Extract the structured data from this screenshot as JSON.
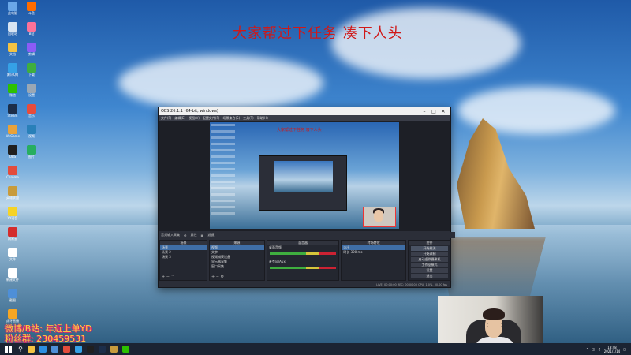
{
  "overlay_banner": "大家帮过下任务 凑下人头",
  "promo_lines": [
    "微博/B站: 年近上单YD",
    "粉丝群: 230459531"
  ],
  "obs": {
    "window_title": "OBS 26.1.1 (64-bit, windows)",
    "menu": [
      "文件(F)",
      "编辑(E)",
      "视图(V)",
      "配置文件(P)",
      "场景集合(S)",
      "工具(T)",
      "帮助(H)"
    ],
    "inner_banner": "大家帮过下任务 凑下人头",
    "controls_bar": [
      "音频输入采集",
      "属性",
      "滤镜"
    ],
    "docks": {
      "scenes": {
        "title": "场景",
        "items": [
          "场景",
          "场景 2",
          "场景 3"
        ]
      },
      "sources": {
        "title": "来源",
        "items": [
          "视频",
          "文字",
          "视频捕获设备",
          "显示器采集",
          "窗口采集"
        ]
      },
      "mixer": {
        "title": "混音器",
        "items": [
          "桌面音频",
          "麦克风/Aux"
        ]
      },
      "transitions": {
        "title": "转场特效",
        "type": "淡出",
        "duration_label": "时长",
        "duration": "300 ms"
      },
      "controls": {
        "title": "控件",
        "buttons": [
          "开始推流",
          "开始录制",
          "启动虚拟摄像机",
          "工作室模式",
          "设置",
          "退出"
        ]
      }
    },
    "status": "LIVE: 00:00:00   REC: 00:00:00   CPU: 1.0%, 30.00 fps"
  },
  "taskbar": {
    "time": "13:48",
    "date": "2021/1/14",
    "apps": [
      {
        "name": "file-explorer",
        "color": "#f3c343"
      },
      {
        "name": "edge",
        "color": "#2c8ee0"
      },
      {
        "name": "store",
        "color": "#4e8fd8"
      },
      {
        "name": "chrome",
        "color": "#e34c3c"
      },
      {
        "name": "qq",
        "color": "#35a1e6"
      },
      {
        "name": "obs",
        "color": "#202020"
      },
      {
        "name": "steam",
        "color": "#1c2e4a"
      },
      {
        "name": "game",
        "color": "#c89b3c"
      },
      {
        "name": "wechat",
        "color": "#2dc100"
      }
    ]
  },
  "desktop_icons": [
    {
      "label": "此电脑",
      "color": "#6aa7e8"
    },
    {
      "label": "回收站",
      "color": "#d7e4f2"
    },
    {
      "label": "文档",
      "color": "#f3c343"
    },
    {
      "label": "腾讯QQ",
      "color": "#35a1e6"
    },
    {
      "label": "微信",
      "color": "#2dc100"
    },
    {
      "label": "Steam",
      "color": "#1c2e4a"
    },
    {
      "label": "WeGame",
      "color": "#e8a23a"
    },
    {
      "label": "OBS",
      "color": "#202020"
    },
    {
      "label": "Chrome",
      "color": "#e34c3c"
    },
    {
      "label": "英雄联盟",
      "color": "#c89b3c"
    },
    {
      "label": "YY语音",
      "color": "#f5d327"
    },
    {
      "label": "网易云",
      "color": "#d42d2d"
    },
    {
      "label": "文件",
      "color": "#ffffff"
    },
    {
      "label": "新建文件",
      "color": "#ffffff"
    },
    {
      "label": "截图",
      "color": "#4e8fd8"
    },
    {
      "label": "虎牙直播",
      "color": "#f5a623"
    },
    {
      "label": "斗鱼",
      "color": "#ff6c00"
    },
    {
      "label": "B站",
      "color": "#fb7299"
    },
    {
      "label": "剪辑",
      "color": "#8b5cf6"
    },
    {
      "label": "下载",
      "color": "#3fae3f"
    },
    {
      "label": "设置",
      "color": "#9aa7b4"
    },
    {
      "label": "音乐",
      "color": "#e74c3c"
    },
    {
      "label": "视频",
      "color": "#2980b9"
    },
    {
      "label": "图片",
      "color": "#27ae60"
    }
  ]
}
